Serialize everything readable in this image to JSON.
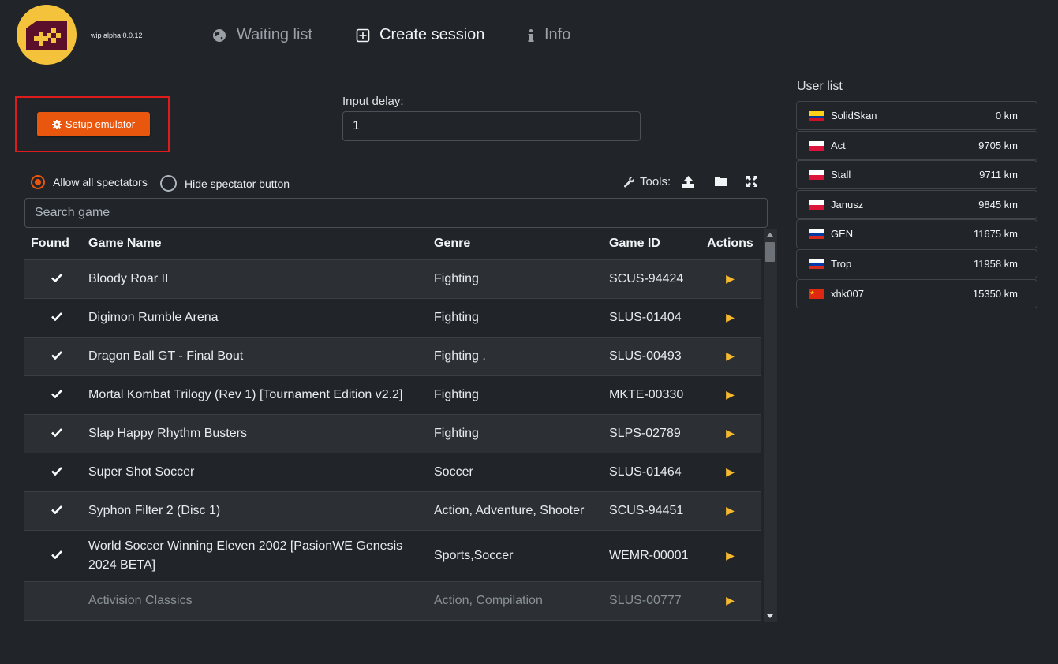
{
  "app": {
    "version": "wip alpha 0.0.12"
  },
  "nav": [
    {
      "label": "Waiting list",
      "icon": "globe-icon"
    },
    {
      "label": "Create session",
      "icon": "plus-square-icon"
    },
    {
      "label": "Info",
      "icon": "info-icon"
    }
  ],
  "setup": {
    "label": "Setup emulator",
    "icon": "gear-icon"
  },
  "input_delay": {
    "label": "Input delay:",
    "value": "1"
  },
  "spectators": {
    "allow_label": "Allow all spectators",
    "hide_label": "Hide spectator button",
    "selected": "allow"
  },
  "tools": {
    "label": "Tools:",
    "icons": [
      "upload-icon",
      "folder-icon",
      "expand-icon"
    ]
  },
  "search": {
    "placeholder": "Search game"
  },
  "table": {
    "headers": [
      "Found",
      "Game Name",
      "Genre",
      "Game ID",
      "Actions"
    ],
    "rows": [
      {
        "found": true,
        "name": "Bloody Roar II",
        "genre": "Fighting",
        "id": "SCUS-94424"
      },
      {
        "found": true,
        "name": "Digimon Rumble Arena",
        "genre": "Fighting",
        "id": "SLUS-01404"
      },
      {
        "found": true,
        "name": "Dragon Ball GT - Final Bout",
        "genre": "Fighting .",
        "id": "SLUS-00493"
      },
      {
        "found": true,
        "name": "Mortal Kombat Trilogy (Rev 1) [Tournament Edition v2.2]",
        "genre": "Fighting",
        "id": "MKTE-00330"
      },
      {
        "found": true,
        "name": "Slap Happy Rhythm Busters",
        "genre": "Fighting",
        "id": "SLPS-02789"
      },
      {
        "found": true,
        "name": "Super Shot Soccer",
        "genre": "Soccer",
        "id": "SLUS-01464"
      },
      {
        "found": true,
        "name": "Syphon Filter 2 (Disc 1)",
        "genre": "Action, Adventure, Shooter",
        "id": "SCUS-94451"
      },
      {
        "found": true,
        "name": "World Soccer Winning Eleven 2002 [PasionWE Genesis 2024 BETA]",
        "genre": "Sports,Soccer",
        "id": "WEMR-00001"
      },
      {
        "found": false,
        "name": "Activision Classics",
        "genre": "Action, Compilation",
        "id": "SLUS-00777"
      }
    ]
  },
  "userlist": {
    "title": "User list",
    "users": [
      {
        "name": "SolidSkan",
        "distance": "0 km",
        "flag": "colombia"
      },
      {
        "name": "Act",
        "distance": "9705 km",
        "flag": "poland"
      },
      {
        "name": "Stall",
        "distance": "9711 km",
        "flag": "poland"
      },
      {
        "name": "Janusz",
        "distance": "9845 km",
        "flag": "poland"
      },
      {
        "name": "GEN",
        "distance": "11675 km",
        "flag": "russia"
      },
      {
        "name": "Trop",
        "distance": "11958 km",
        "flag": "russia"
      },
      {
        "name": "xhk007",
        "distance": "15350 km",
        "flag": "china"
      }
    ]
  },
  "colors": {
    "background": "#212529",
    "accent": "#e9560e",
    "play": "#f5b82e",
    "logo": "#f5c33b",
    "highlight_border": "#e01b1b"
  }
}
